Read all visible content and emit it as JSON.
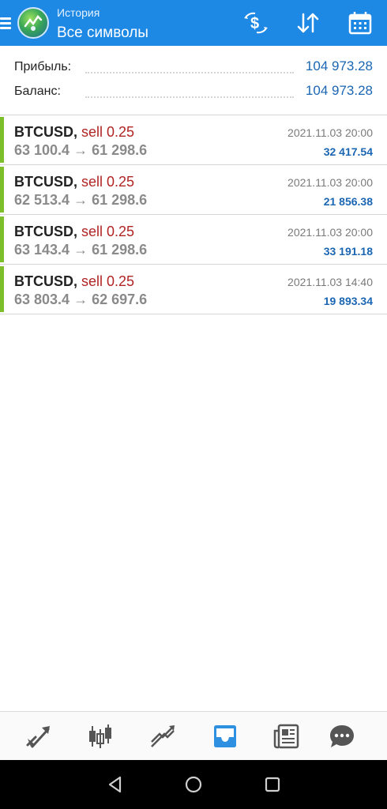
{
  "header": {
    "title": "История",
    "subtitle": "Все символы",
    "actions": [
      "currency-exchange-icon",
      "sort-icon",
      "calendar-icon"
    ]
  },
  "summary": {
    "profit_label": "Прибыль:",
    "profit_value": "104 973.28",
    "balance_label": "Баланс:",
    "balance_value": "104 973.28"
  },
  "deals": [
    {
      "symbol": "BTCUSD,",
      "side": "sell 0.25",
      "prices": "63 100.4 → 61 298.6",
      "time": "2021.11.03 20:00",
      "profit": "32 417.54"
    },
    {
      "symbol": "BTCUSD,",
      "side": "sell 0.25",
      "prices": "62 513.4 → 61 298.6",
      "time": "2021.11.03 20:00",
      "profit": "21 856.38"
    },
    {
      "symbol": "BTCUSD,",
      "side": "sell 0.25",
      "prices": "63 143.4 → 61 298.6",
      "time": "2021.11.03 20:00",
      "profit": "33 191.18"
    },
    {
      "symbol": "BTCUSD,",
      "side": "sell 0.25",
      "prices": "63 803.4 → 62 697.6",
      "time": "2021.11.03 14:40",
      "profit": "19 893.34"
    }
  ],
  "tabs": [
    "quotes-icon",
    "chart-icon",
    "trade-icon",
    "history-icon",
    "news-icon",
    "messages-icon"
  ],
  "active_tab": "history-icon",
  "colors": {
    "appbar": "#1e88e5",
    "accent_blue": "#1b66b3",
    "sell_red": "#b02424",
    "profit_bar_green": "#7cbf2a"
  }
}
